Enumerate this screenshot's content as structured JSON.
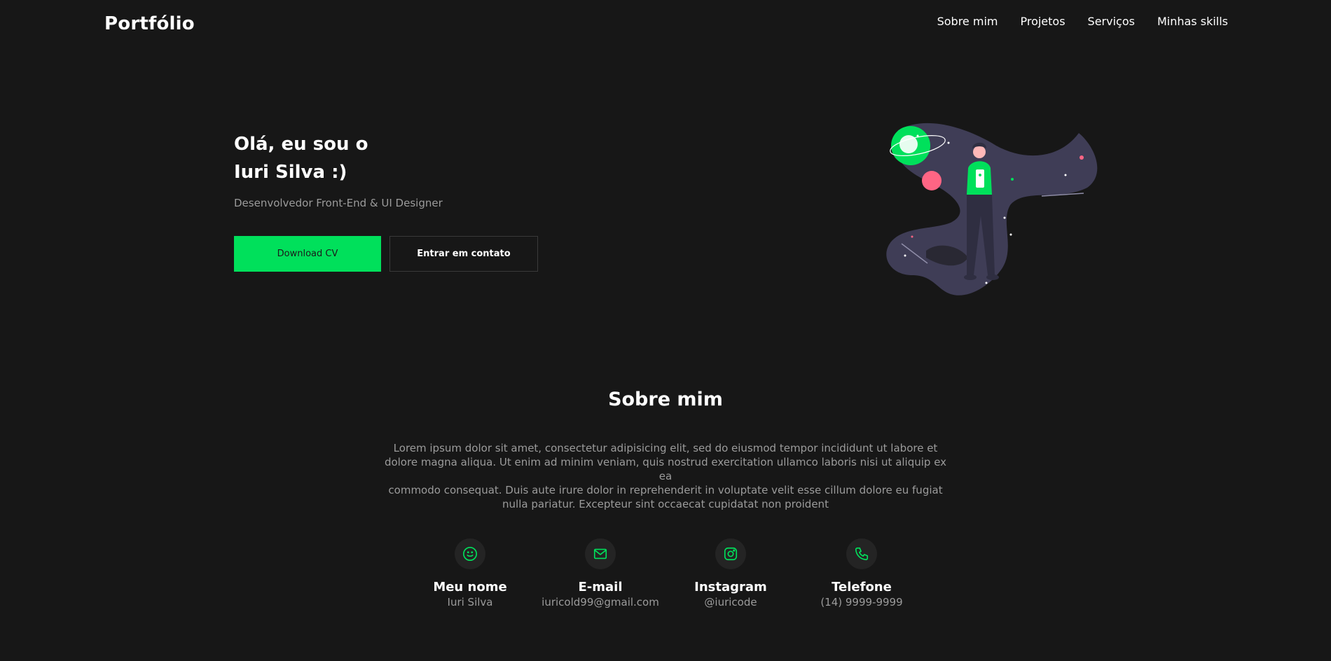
{
  "header": {
    "logo": "Portfólio",
    "nav": [
      "Sobre mim",
      "Projetos",
      "Serviços",
      "Minhas skills"
    ]
  },
  "hero": {
    "title_line1": "Olá, eu sou o",
    "title_line2": "Iuri Silva :)",
    "subtitle": "Desenvolvedor Front-End & UI Designer",
    "download_label": "Download CV",
    "contact_label": "Entrar em contato"
  },
  "about": {
    "title": "Sobre mim",
    "text_lines": [
      "Lorem ipsum dolor sit amet, consectetur adipisicing elit, sed do eiusmod tempor incididunt ut labore et",
      "dolore magna aliqua. Ut enim ad minim veniam, quis nostrud exercitation ullamco laboris nisi ut aliquip ex ea",
      "commodo consequat. Duis aute irure dolor in reprehenderit in voluptate velit esse cillum dolore eu fugiat",
      "nulla pariatur. Excepteur sint occaecat cupidatat non proident"
    ],
    "contacts": [
      {
        "icon": "smile-icon",
        "label": "Meu nome",
        "value": "Iuri Silva"
      },
      {
        "icon": "mail-icon",
        "label": "E-mail",
        "value": "iuricold99@gmail.com"
      },
      {
        "icon": "instagram-icon",
        "label": "Instagram",
        "value": "@iuricode"
      },
      {
        "icon": "phone-icon",
        "label": "Telefone",
        "value": "(14) 9999-9999"
      }
    ]
  },
  "colors": {
    "background": "#171717",
    "accent": "#00e05b",
    "muted_text": "#9b9b9b",
    "icon_circle": "#242424"
  }
}
